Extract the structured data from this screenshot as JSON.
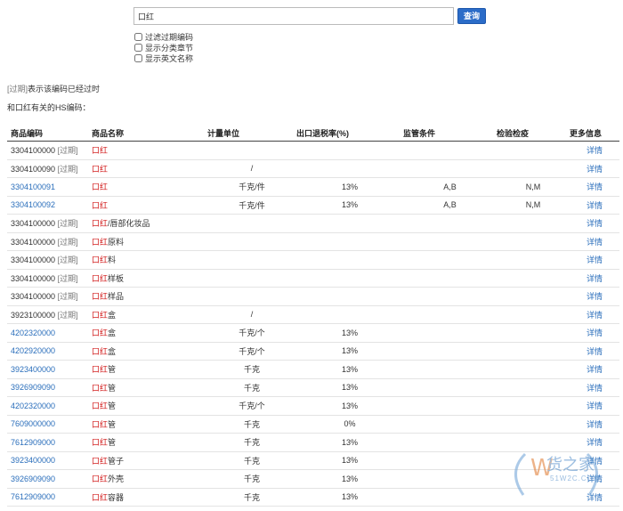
{
  "search": {
    "value": "口红",
    "button_label": "查询"
  },
  "options": [
    {
      "label": "过滤过期编码",
      "checked": false
    },
    {
      "label": "显示分类章节",
      "checked": false
    },
    {
      "label": "显示英文名称",
      "checked": false
    }
  ],
  "hint": {
    "tag": "[过期]",
    "text": "表示该编码已经过时"
  },
  "related_title": "和口红有关的HS编码：",
  "table": {
    "headers": [
      "商品编码",
      "商品名称",
      "计量单位",
      "出口退税率(%)",
      "监管条件",
      "检验检疫",
      "更多信息"
    ],
    "rows": [
      {
        "code": "3304100000",
        "expired": true,
        "hl": "口红",
        "rest": "",
        "unit": "",
        "rate": "",
        "sup": "",
        "insp": "",
        "more": "详情"
      },
      {
        "code": "3304100090",
        "expired": true,
        "hl": "口红",
        "rest": "",
        "unit": "/",
        "rate": "",
        "sup": "",
        "insp": "",
        "more": "详情"
      },
      {
        "code": "3304100091",
        "expired": false,
        "hl": "口红",
        "rest": "",
        "unit": "千克/件",
        "rate": "13%",
        "sup": "A,B",
        "insp": "N,M",
        "more": "详情"
      },
      {
        "code": "3304100092",
        "expired": false,
        "hl": "口红",
        "rest": "",
        "unit": "千克/件",
        "rate": "13%",
        "sup": "A,B",
        "insp": "N,M",
        "more": "详情"
      },
      {
        "code": "3304100000",
        "expired": true,
        "hl": "口红",
        "rest": "/唇部化妆品",
        "unit": "",
        "rate": "",
        "sup": "",
        "insp": "",
        "more": "详情"
      },
      {
        "code": "3304100000",
        "expired": true,
        "hl": "口红",
        "rest": "原料",
        "unit": "",
        "rate": "",
        "sup": "",
        "insp": "",
        "more": "详情"
      },
      {
        "code": "3304100000",
        "expired": true,
        "hl": "口红",
        "rest": "料",
        "unit": "",
        "rate": "",
        "sup": "",
        "insp": "",
        "more": "详情"
      },
      {
        "code": "3304100000",
        "expired": true,
        "hl": "口红",
        "rest": "样板",
        "unit": "",
        "rate": "",
        "sup": "",
        "insp": "",
        "more": "详情"
      },
      {
        "code": "3304100000",
        "expired": true,
        "hl": "口红",
        "rest": "样品",
        "unit": "",
        "rate": "",
        "sup": "",
        "insp": "",
        "more": "详情"
      },
      {
        "code": "3923100000",
        "expired": true,
        "hl": "口红",
        "rest": "盒",
        "unit": "/",
        "rate": "",
        "sup": "",
        "insp": "",
        "more": "详情"
      },
      {
        "code": "4202320000",
        "expired": false,
        "hl": "口红",
        "rest": "盒",
        "unit": "千克/个",
        "rate": "13%",
        "sup": "",
        "insp": "",
        "more": "详情"
      },
      {
        "code": "4202920000",
        "expired": false,
        "hl": "口红",
        "rest": "盒",
        "unit": "千克/个",
        "rate": "13%",
        "sup": "",
        "insp": "",
        "more": "详情"
      },
      {
        "code": "3923400000",
        "expired": false,
        "hl": "口红",
        "rest": "管",
        "unit": "千克",
        "rate": "13%",
        "sup": "",
        "insp": "",
        "more": "详情"
      },
      {
        "code": "3926909090",
        "expired": false,
        "hl": "口红",
        "rest": "管",
        "unit": "千克",
        "rate": "13%",
        "sup": "",
        "insp": "",
        "more": "详情"
      },
      {
        "code": "4202320000",
        "expired": false,
        "hl": "口红",
        "rest": "管",
        "unit": "千克/个",
        "rate": "13%",
        "sup": "",
        "insp": "",
        "more": "详情"
      },
      {
        "code": "7609000000",
        "expired": false,
        "hl": "口红",
        "rest": "管",
        "unit": "千克",
        "rate": "0%",
        "sup": "",
        "insp": "",
        "more": "详情"
      },
      {
        "code": "7612909000",
        "expired": false,
        "hl": "口红",
        "rest": "管",
        "unit": "千克",
        "rate": "13%",
        "sup": "",
        "insp": "",
        "more": "详情"
      },
      {
        "code": "3923400000",
        "expired": false,
        "hl": "口红",
        "rest": "管子",
        "unit": "千克",
        "rate": "13%",
        "sup": "",
        "insp": "",
        "more": "详情"
      },
      {
        "code": "3926909090",
        "expired": false,
        "hl": "口红",
        "rest": "外壳",
        "unit": "千克",
        "rate": "13%",
        "sup": "",
        "insp": "",
        "more": "详情"
      },
      {
        "code": "7612909000",
        "expired": false,
        "hl": "口红",
        "rest": "容器",
        "unit": "千克",
        "rate": "13%",
        "sup": "",
        "insp": "",
        "more": "详情"
      }
    ]
  },
  "watermark": {
    "brand": "货之家",
    "domain": "51W2C.COM"
  },
  "colors": {
    "link": "#2a6ebb",
    "highlight": "#d21c1c",
    "button": "#2b6cc8"
  }
}
